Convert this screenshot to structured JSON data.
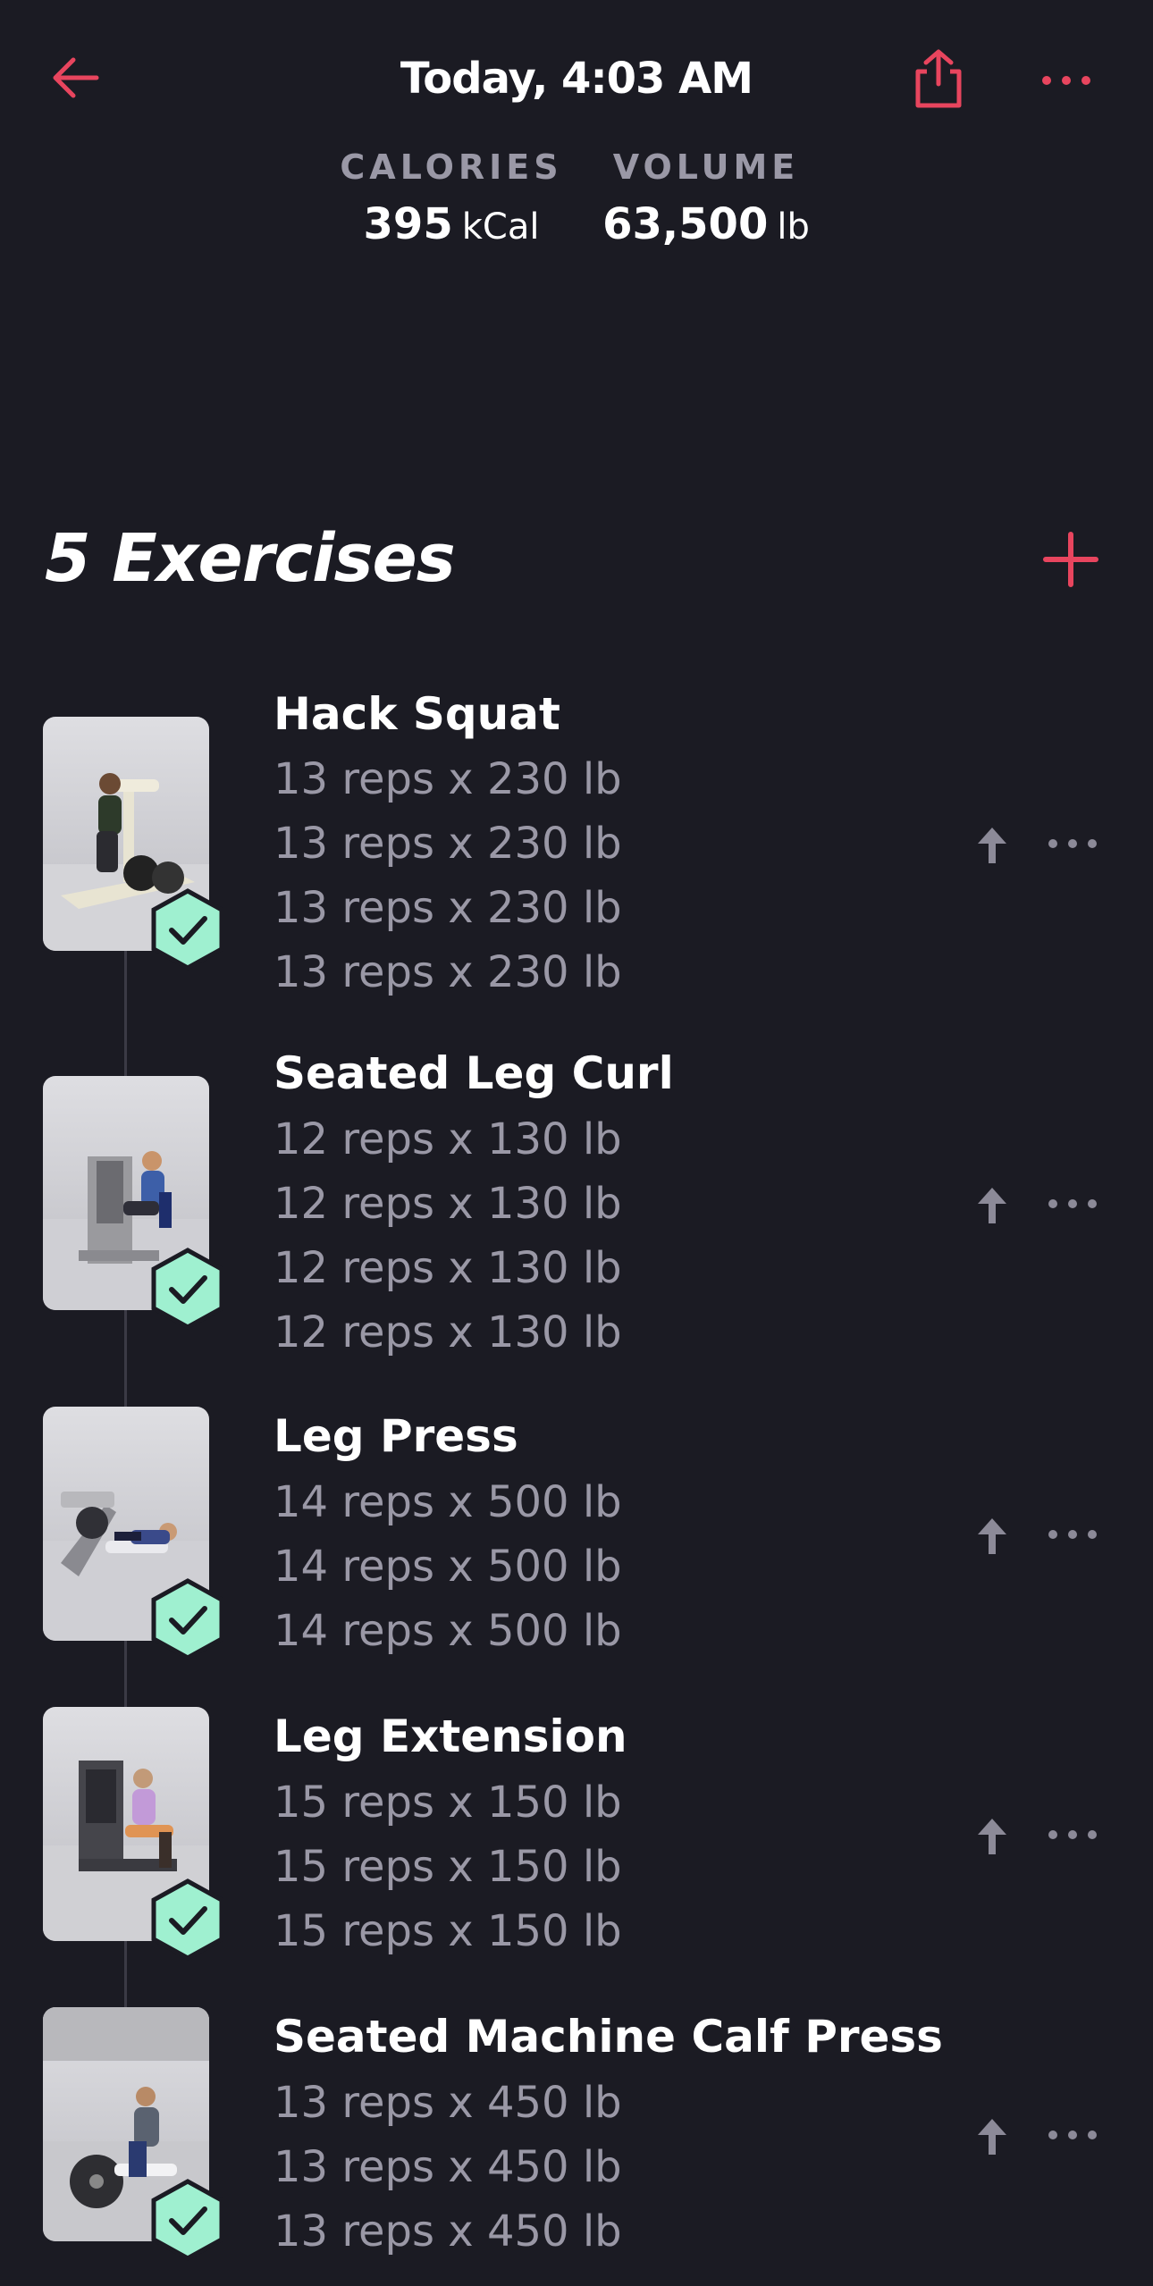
{
  "header": {
    "title": "Today, 4:03 AM"
  },
  "stats": {
    "calories": {
      "label": "CALORIES",
      "value": "395",
      "unit": "kCal"
    },
    "volume": {
      "label": "VOLUME",
      "value": "63,500",
      "unit": "lb"
    }
  },
  "section": {
    "title": "5 Exercises"
  },
  "exercises": [
    {
      "name": "Hack Squat",
      "sets": [
        "13 reps x 230 lb",
        "13 reps x 230 lb",
        "13 reps x 230 lb",
        "13 reps x 230 lb"
      ]
    },
    {
      "name": "Seated Leg Curl",
      "sets": [
        "12 reps x 130 lb",
        "12 reps x 130 lb",
        "12 reps x 130 lb",
        "12 reps x 130 lb"
      ]
    },
    {
      "name": "Leg Press",
      "sets": [
        "14 reps x 500 lb",
        "14 reps x 500 lb",
        "14 reps x 500 lb"
      ]
    },
    {
      "name": "Leg Extension",
      "sets": [
        "15 reps x 150 lb",
        "15 reps x 150 lb",
        "15 reps x 150 lb"
      ]
    },
    {
      "name": "Seated Machine Calf Press",
      "sets": [
        "13 reps x 450 lb",
        "13 reps x 450 lb",
        "13 reps x 450 lb"
      ]
    }
  ],
  "colors": {
    "accent": "#e8455e",
    "background": "#1b1b23",
    "muted_text": "#9a98a6",
    "check_fill": "#9ff0d0",
    "check_stroke": "#1b1b23"
  },
  "icons": {
    "back": "arrow-left-icon",
    "share": "share-icon",
    "more": "ellipsis-icon",
    "add": "plus-icon",
    "reorder": "arrow-up-icon",
    "completed": "check-hexagon-icon"
  }
}
